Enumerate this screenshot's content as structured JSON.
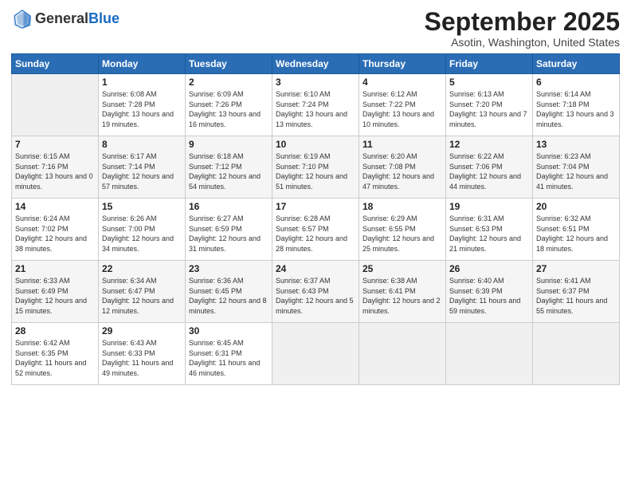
{
  "logo": {
    "general": "General",
    "blue": "Blue"
  },
  "header": {
    "month": "September 2025",
    "location": "Asotin, Washington, United States"
  },
  "weekdays": [
    "Sunday",
    "Monday",
    "Tuesday",
    "Wednesday",
    "Thursday",
    "Friday",
    "Saturday"
  ],
  "weeks": [
    [
      {
        "day": "",
        "empty": true
      },
      {
        "day": "1",
        "sunrise": "Sunrise: 6:08 AM",
        "sunset": "Sunset: 7:28 PM",
        "daylight": "Daylight: 13 hours and 19 minutes."
      },
      {
        "day": "2",
        "sunrise": "Sunrise: 6:09 AM",
        "sunset": "Sunset: 7:26 PM",
        "daylight": "Daylight: 13 hours and 16 minutes."
      },
      {
        "day": "3",
        "sunrise": "Sunrise: 6:10 AM",
        "sunset": "Sunset: 7:24 PM",
        "daylight": "Daylight: 13 hours and 13 minutes."
      },
      {
        "day": "4",
        "sunrise": "Sunrise: 6:12 AM",
        "sunset": "Sunset: 7:22 PM",
        "daylight": "Daylight: 13 hours and 10 minutes."
      },
      {
        "day": "5",
        "sunrise": "Sunrise: 6:13 AM",
        "sunset": "Sunset: 7:20 PM",
        "daylight": "Daylight: 13 hours and 7 minutes."
      },
      {
        "day": "6",
        "sunrise": "Sunrise: 6:14 AM",
        "sunset": "Sunset: 7:18 PM",
        "daylight": "Daylight: 13 hours and 3 minutes."
      }
    ],
    [
      {
        "day": "7",
        "sunrise": "Sunrise: 6:15 AM",
        "sunset": "Sunset: 7:16 PM",
        "daylight": "Daylight: 13 hours and 0 minutes."
      },
      {
        "day": "8",
        "sunrise": "Sunrise: 6:17 AM",
        "sunset": "Sunset: 7:14 PM",
        "daylight": "Daylight: 12 hours and 57 minutes."
      },
      {
        "day": "9",
        "sunrise": "Sunrise: 6:18 AM",
        "sunset": "Sunset: 7:12 PM",
        "daylight": "Daylight: 12 hours and 54 minutes."
      },
      {
        "day": "10",
        "sunrise": "Sunrise: 6:19 AM",
        "sunset": "Sunset: 7:10 PM",
        "daylight": "Daylight: 12 hours and 51 minutes."
      },
      {
        "day": "11",
        "sunrise": "Sunrise: 6:20 AM",
        "sunset": "Sunset: 7:08 PM",
        "daylight": "Daylight: 12 hours and 47 minutes."
      },
      {
        "day": "12",
        "sunrise": "Sunrise: 6:22 AM",
        "sunset": "Sunset: 7:06 PM",
        "daylight": "Daylight: 12 hours and 44 minutes."
      },
      {
        "day": "13",
        "sunrise": "Sunrise: 6:23 AM",
        "sunset": "Sunset: 7:04 PM",
        "daylight": "Daylight: 12 hours and 41 minutes."
      }
    ],
    [
      {
        "day": "14",
        "sunrise": "Sunrise: 6:24 AM",
        "sunset": "Sunset: 7:02 PM",
        "daylight": "Daylight: 12 hours and 38 minutes."
      },
      {
        "day": "15",
        "sunrise": "Sunrise: 6:26 AM",
        "sunset": "Sunset: 7:00 PM",
        "daylight": "Daylight: 12 hours and 34 minutes."
      },
      {
        "day": "16",
        "sunrise": "Sunrise: 6:27 AM",
        "sunset": "Sunset: 6:59 PM",
        "daylight": "Daylight: 12 hours and 31 minutes."
      },
      {
        "day": "17",
        "sunrise": "Sunrise: 6:28 AM",
        "sunset": "Sunset: 6:57 PM",
        "daylight": "Daylight: 12 hours and 28 minutes."
      },
      {
        "day": "18",
        "sunrise": "Sunrise: 6:29 AM",
        "sunset": "Sunset: 6:55 PM",
        "daylight": "Daylight: 12 hours and 25 minutes."
      },
      {
        "day": "19",
        "sunrise": "Sunrise: 6:31 AM",
        "sunset": "Sunset: 6:53 PM",
        "daylight": "Daylight: 12 hours and 21 minutes."
      },
      {
        "day": "20",
        "sunrise": "Sunrise: 6:32 AM",
        "sunset": "Sunset: 6:51 PM",
        "daylight": "Daylight: 12 hours and 18 minutes."
      }
    ],
    [
      {
        "day": "21",
        "sunrise": "Sunrise: 6:33 AM",
        "sunset": "Sunset: 6:49 PM",
        "daylight": "Daylight: 12 hours and 15 minutes."
      },
      {
        "day": "22",
        "sunrise": "Sunrise: 6:34 AM",
        "sunset": "Sunset: 6:47 PM",
        "daylight": "Daylight: 12 hours and 12 minutes."
      },
      {
        "day": "23",
        "sunrise": "Sunrise: 6:36 AM",
        "sunset": "Sunset: 6:45 PM",
        "daylight": "Daylight: 12 hours and 8 minutes."
      },
      {
        "day": "24",
        "sunrise": "Sunrise: 6:37 AM",
        "sunset": "Sunset: 6:43 PM",
        "daylight": "Daylight: 12 hours and 5 minutes."
      },
      {
        "day": "25",
        "sunrise": "Sunrise: 6:38 AM",
        "sunset": "Sunset: 6:41 PM",
        "daylight": "Daylight: 12 hours and 2 minutes."
      },
      {
        "day": "26",
        "sunrise": "Sunrise: 6:40 AM",
        "sunset": "Sunset: 6:39 PM",
        "daylight": "Daylight: 11 hours and 59 minutes."
      },
      {
        "day": "27",
        "sunrise": "Sunrise: 6:41 AM",
        "sunset": "Sunset: 6:37 PM",
        "daylight": "Daylight: 11 hours and 55 minutes."
      }
    ],
    [
      {
        "day": "28",
        "sunrise": "Sunrise: 6:42 AM",
        "sunset": "Sunset: 6:35 PM",
        "daylight": "Daylight: 11 hours and 52 minutes."
      },
      {
        "day": "29",
        "sunrise": "Sunrise: 6:43 AM",
        "sunset": "Sunset: 6:33 PM",
        "daylight": "Daylight: 11 hours and 49 minutes."
      },
      {
        "day": "30",
        "sunrise": "Sunrise: 6:45 AM",
        "sunset": "Sunset: 6:31 PM",
        "daylight": "Daylight: 11 hours and 46 minutes."
      },
      {
        "day": "",
        "empty": true
      },
      {
        "day": "",
        "empty": true
      },
      {
        "day": "",
        "empty": true
      },
      {
        "day": "",
        "empty": true
      }
    ]
  ]
}
